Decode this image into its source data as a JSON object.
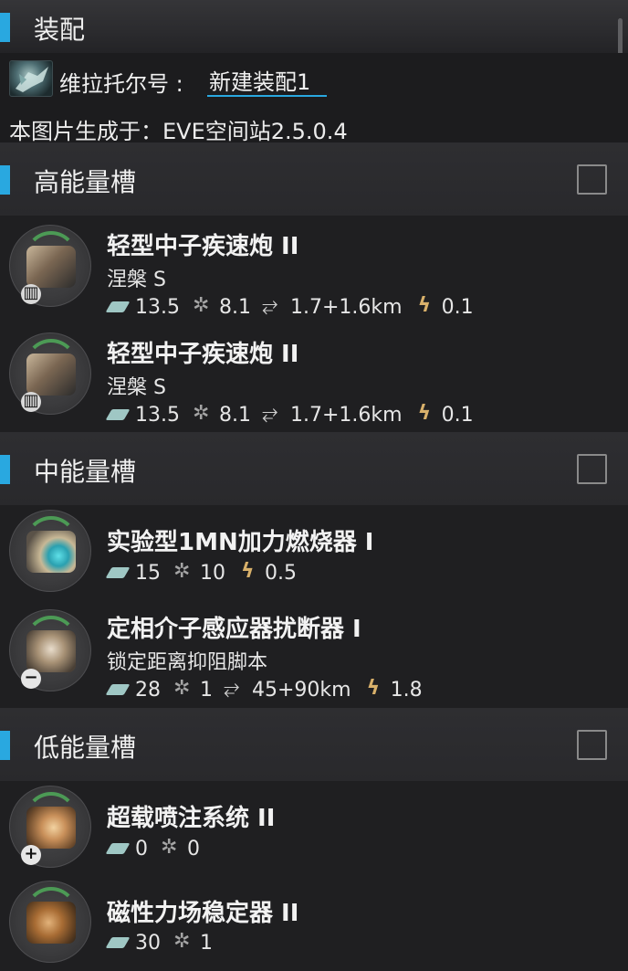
{
  "header": {
    "title": "装配"
  },
  "fit": {
    "ship_label": "维拉托尔号 :",
    "fit_name": "新建装配1",
    "generated_text": "本图片生成于：EVE空间站2.5.0.4"
  },
  "sections": {
    "high": {
      "title": "高能量槽"
    },
    "mid": {
      "title": "中能量槽"
    },
    "low": {
      "title": "低能量槽"
    }
  },
  "modules": {
    "h1": {
      "name": "轻型中子疾速炮 II",
      "charge": "涅槃 S",
      "cpu": "13.5",
      "pg": "8.1",
      "range": "1.7+1.6km",
      "cap": "0.1",
      "icon": "blaster-turret-icon"
    },
    "h2": {
      "name": "轻型中子疾速炮 II",
      "charge": "涅槃 S",
      "cpu": "13.5",
      "pg": "8.1",
      "range": "1.7+1.6km",
      "cap": "0.1",
      "icon": "blaster-turret-icon"
    },
    "m1": {
      "name": "实验型1MN加力燃烧器 I",
      "cpu": "15",
      "pg": "10",
      "cap": "0.5",
      "icon": "afterburner-icon"
    },
    "m2": {
      "name": "定相介子感应器扰断器 I",
      "charge": "锁定距离抑阻脚本",
      "cpu": "28",
      "pg": "1",
      "range": "45+90km",
      "cap": "1.8",
      "icon": "sensor-dampener-icon"
    },
    "l1": {
      "name": "超载喷注系统 II",
      "cpu": "0",
      "pg": "0",
      "icon": "overdrive-injector-icon"
    },
    "l2": {
      "name": "磁性力场稳定器 II",
      "cpu": "30",
      "pg": "1",
      "icon": "magnetic-field-stabilizer-icon"
    }
  },
  "colors": {
    "accent": "#29a8e0",
    "background": "#1f1f21",
    "arc": "#4c9a55"
  }
}
